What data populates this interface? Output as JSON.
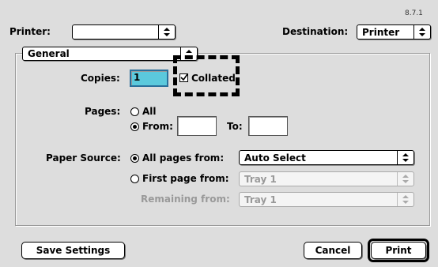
{
  "version": "8.7.1",
  "printer": {
    "label": "Printer:",
    "value": ""
  },
  "destination": {
    "label": "Destination:",
    "value": "Printer"
  },
  "panel": {
    "value": "General"
  },
  "copies": {
    "label": "Copies:",
    "value": "1",
    "collated_label": "Collated",
    "collated_checked": true
  },
  "pages": {
    "label": "Pages:",
    "all_label": "All",
    "from_label": "From:",
    "from_value": "",
    "to_label": "To:",
    "to_value": "",
    "selected": "from"
  },
  "paper_source": {
    "label": "Paper Source:",
    "all_pages_label": "All pages from:",
    "all_pages_value": "Auto Select",
    "first_page_label": "First page from:",
    "first_page_value": "Tray 1",
    "remaining_label": "Remaining from:",
    "remaining_value": "Tray 1",
    "selected": "all"
  },
  "buttons": {
    "save_settings": "Save Settings",
    "cancel": "Cancel",
    "print": "Print"
  },
  "icons": {
    "popup_arrows": "up-down-arrows-icon",
    "radio": "radio-icon",
    "checkbox": "checkmark-icon"
  }
}
